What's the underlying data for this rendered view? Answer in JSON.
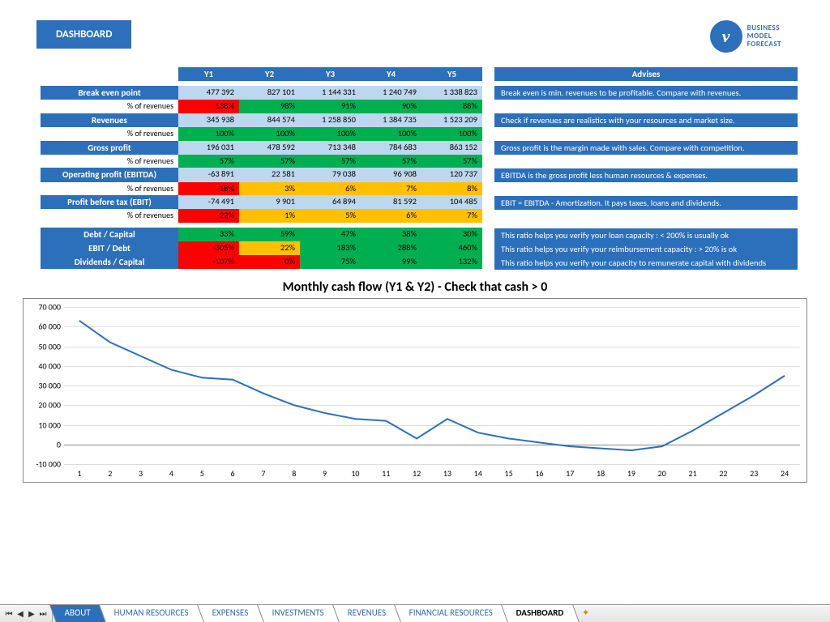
{
  "header": {
    "title": "DASHBOARD",
    "logo_lines": [
      "BUSINESS",
      "MODEL",
      "FORECAST"
    ],
    "logo_glyph": "v"
  },
  "years": [
    "Y1",
    "Y2",
    "Y3",
    "Y4",
    "Y5"
  ],
  "advises_header": "Advises",
  "main_rows": [
    {
      "label": "Break even point",
      "vals": [
        "477 392",
        "827 101",
        "1 144 331",
        "1 240 749",
        "1 338 823"
      ],
      "cls": "c-lblue",
      "advise": "Break even is min. revenues to be profitable. Compare with revenues."
    },
    {
      "label": "% of revenues",
      "sub": true,
      "vals": [
        "138%",
        "98%",
        "91%",
        "90%",
        "88%"
      ],
      "clsList": [
        "c-red",
        "c-green",
        "c-green",
        "c-green",
        "c-green"
      ]
    },
    {
      "label": "Revenues",
      "vals": [
        "345 938",
        "844 574",
        "1 258 850",
        "1 384 735",
        "1 523 209"
      ],
      "cls": "c-lblue",
      "advise": "Check if revenues are realistics with your resources and market size."
    },
    {
      "label": "% of revenues",
      "sub": true,
      "vals": [
        "100%",
        "100%",
        "100%",
        "100%",
        "100%"
      ],
      "cls": "c-green"
    },
    {
      "label": "Gross profit",
      "vals": [
        "196 031",
        "478 592",
        "713 348",
        "784 683",
        "863 152"
      ],
      "cls": "c-lblue",
      "advise": "Gross profit is the margin made with sales. Compare with competition."
    },
    {
      "label": "% of revenues",
      "sub": true,
      "vals": [
        "57%",
        "57%",
        "57%",
        "57%",
        "57%"
      ],
      "cls": "c-green"
    },
    {
      "label": "Operating profit (EBITDA)",
      "vals": [
        "-63 891",
        "22 581",
        "79 038",
        "96 908",
        "120 737"
      ],
      "cls": "c-lblue",
      "advise": "EBITDA is the gross profit less human resources & expenses."
    },
    {
      "label": "% of revenues",
      "sub": true,
      "vals": [
        "-18%",
        "3%",
        "6%",
        "7%",
        "8%"
      ],
      "clsList": [
        "c-red",
        "c-yel",
        "c-yel",
        "c-yel",
        "c-yel"
      ]
    },
    {
      "label": "Profit before tax (EBIT)",
      "vals": [
        "-74 491",
        "9 901",
        "64 894",
        "81 592",
        "104 485"
      ],
      "cls": "c-lblue",
      "advise": "EBIT = EBITDA - Amortization. It pays taxes, loans and dividends."
    },
    {
      "label": "% of revenues",
      "sub": true,
      "vals": [
        "-22%",
        "1%",
        "5%",
        "6%",
        "7%"
      ],
      "clsList": [
        "c-red",
        "c-yel",
        "c-yel",
        "c-yel",
        "c-yel"
      ]
    }
  ],
  "ratio_rows": [
    {
      "label": "Debt / Capital",
      "vals": [
        "33%",
        "59%",
        "47%",
        "38%",
        "30%"
      ],
      "cls": "c-green",
      "advise": "This ratio helps you verify your loan capacity : < 200% is usually ok"
    },
    {
      "label": "EBIT / Debt",
      "vals": [
        "-305%",
        "22%",
        "183%",
        "288%",
        "460%"
      ],
      "clsList": [
        "c-red",
        "c-yel",
        "c-green",
        "c-green",
        "c-green"
      ],
      "advise": "This ratio helps you verify your reimbursement capacity : > 20% is ok"
    },
    {
      "label": "Dividends / Capital",
      "vals": [
        "-107%",
        "0%",
        "75%",
        "99%",
        "132%"
      ],
      "clsList": [
        "c-red",
        "c-red",
        "c-green",
        "c-green",
        "c-green"
      ],
      "advise": "This ratio helps you verify your capacity to remunerate capital with dividends"
    }
  ],
  "chart_data": {
    "type": "line",
    "title": "Monthly cash flow (Y1 & Y2) - Check that cash > 0",
    "x": [
      1,
      2,
      3,
      4,
      5,
      6,
      7,
      8,
      9,
      10,
      11,
      12,
      13,
      14,
      15,
      16,
      17,
      18,
      19,
      20,
      21,
      22,
      23,
      24
    ],
    "values": [
      63000,
      52000,
      45000,
      38000,
      34000,
      33000,
      26000,
      20000,
      16000,
      13000,
      12000,
      3000,
      13000,
      6000,
      3000,
      1000,
      -1000,
      -2000,
      -3000,
      -1000,
      7000,
      16000,
      25000,
      35000
    ],
    "ylabel": "",
    "xlabel": "",
    "ylim": [
      -10000,
      70000
    ],
    "yticks": [
      -10000,
      0,
      10000,
      20000,
      30000,
      40000,
      50000,
      60000,
      70000
    ],
    "ytick_labels": [
      "-10 000",
      "0",
      "10 000",
      "20 000",
      "30 000",
      "40 000",
      "50 000",
      "60 000",
      "70 000"
    ]
  },
  "tabs": [
    "ABOUT",
    "HUMAN RESOURCES",
    "EXPENSES",
    "INVESTMENTS",
    "REVENUES",
    "FINANCIAL RESOURCES",
    "DASHBOARD"
  ],
  "active_tab": "DASHBOARD"
}
